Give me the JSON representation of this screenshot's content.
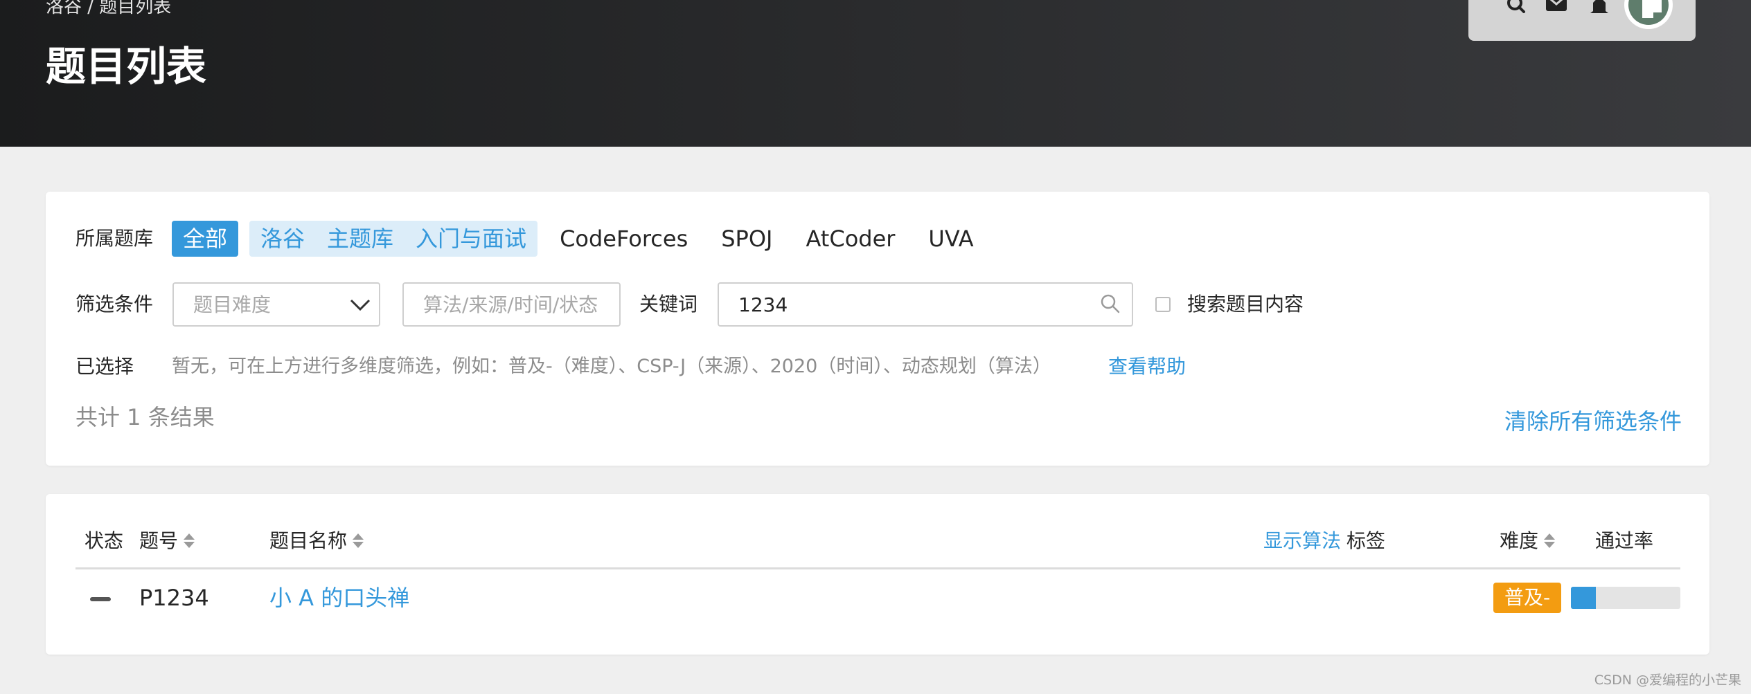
{
  "header": {
    "breadcrumb": "洛谷 / 题目列表",
    "title": "题目列表",
    "icons": [
      "search-icon",
      "mail-icon",
      "bell-icon",
      "avatar"
    ]
  },
  "filters": {
    "source_label": "所属题库",
    "sources": {
      "active": "全部",
      "grouped": [
        "洛谷",
        "主题库",
        "入门与面试"
      ],
      "others": [
        "CodeForces",
        "SPOJ",
        "AtCoder",
        "UVA"
      ]
    },
    "condition_label": "筛选条件",
    "difficulty_placeholder": "题目难度",
    "tags_placeholder": "算法/来源/时间/状态",
    "keyword_label": "关键词",
    "keyword_value": "1234",
    "search_content_label": "搜索题目内容",
    "search_content_checked": false,
    "selected_label": "已选择",
    "selected_hint": "暂无，可在上方进行多维度筛选，例如：普及-（难度）、CSP-J（来源）、2020（时间）、动态规划（算法）",
    "help_link": "查看帮助",
    "result_count": "共计 1 条结果",
    "clear_link": "清除所有筛选条件"
  },
  "table": {
    "headers": {
      "status": "状态",
      "pid": "题号",
      "name": "题目名称",
      "show_algo": "显示算法",
      "tags": "标签",
      "difficulty": "难度",
      "pass_rate": "通过率"
    },
    "rows": [
      {
        "status": "—",
        "pid": "P1234",
        "title": "小 A 的口头禅",
        "difficulty": "普及-",
        "difficulty_color": "#f39c11",
        "pass_rate_fraction": 0.23
      }
    ]
  },
  "colors": {
    "accent": "#3498db",
    "header_bg": "#2a2b2d",
    "page_bg": "#efefef"
  },
  "watermark": "CSDN @爱编程的小芒果"
}
